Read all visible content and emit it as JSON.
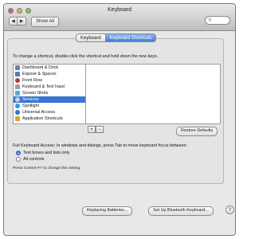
{
  "window": {
    "title": "Keyboard"
  },
  "toolbar": {
    "back_glyph": "◀",
    "forward_glyph": "▶",
    "show_all_label": "Show All",
    "search_icon": "magnifier-icon"
  },
  "tabs": [
    {
      "label": "Keyboard",
      "active": false
    },
    {
      "label": "Keyboard Shortcuts",
      "active": true
    }
  ],
  "instructions": "To change a shortcut, double-click the shortcut and hold down the new keys.",
  "categories": [
    {
      "label": "Dashboard & Dock",
      "icon": "dashboard-dock-icon",
      "color": "#6b7fa8",
      "selected": false
    },
    {
      "label": "Exposé & Spaces",
      "icon": "expose-spaces-icon",
      "color": "#4a7cc8",
      "selected": false
    },
    {
      "label": "Front Row",
      "icon": "front-row-icon",
      "color": "#c0392b",
      "selected": false
    },
    {
      "label": "Keyboard & Text Input",
      "icon": "keyboard-icon",
      "color": "#9aa0a6",
      "selected": false
    },
    {
      "label": "Screen Shots",
      "icon": "screen-shots-icon",
      "color": "#5fa3d8",
      "selected": false
    },
    {
      "label": "Services",
      "icon": "services-icon",
      "color": "#7f8c8d",
      "selected": true
    },
    {
      "label": "Spotlight",
      "icon": "spotlight-icon",
      "color": "#3a8fd9",
      "selected": false
    },
    {
      "label": "Universal Access",
      "icon": "universal-access-icon",
      "color": "#2e74c9",
      "selected": false
    },
    {
      "label": "Application Shortcuts",
      "icon": "application-shortcuts-icon",
      "color": "#d9a53a",
      "selected": false
    }
  ],
  "list_controls": {
    "add": "+",
    "remove": "−"
  },
  "restore_defaults_label": "Restore Defaults",
  "full_keyboard_access": {
    "text": "Full Keyboard Access: In windows and dialogs, press Tab to move keyboard focus between:",
    "options": [
      {
        "label": "Text boxes and lists only",
        "selected": true
      },
      {
        "label": "All controls",
        "selected": false
      }
    ],
    "hint": "Press Control+F7 to change this setting."
  },
  "bottom_buttons": {
    "replacing_batteries": "Replacing Batteries...",
    "bluetooth": "Set Up Bluetooth Keyboard..."
  },
  "help_label": "?"
}
